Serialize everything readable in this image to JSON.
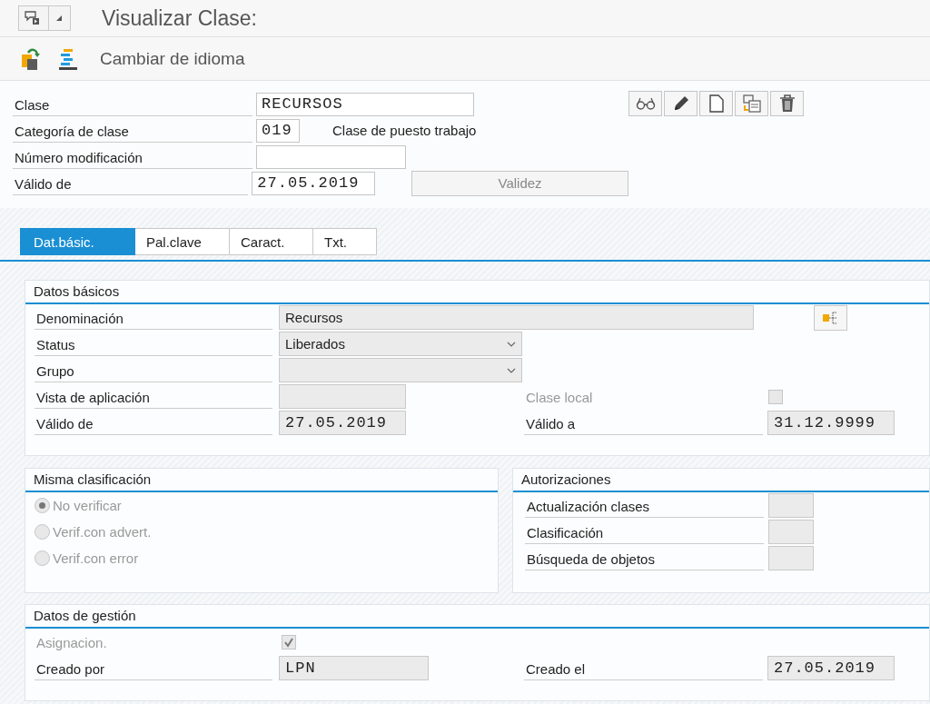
{
  "window": {
    "title": "Visualizar Clase:"
  },
  "toolbar": {
    "label": "Cambiar de idioma"
  },
  "header": {
    "fields": [
      {
        "kind": "text",
        "label": "Clase",
        "value": "RECURSOS"
      },
      {
        "kind": "short",
        "label": "Categoría de clase",
        "value": "019",
        "note": "Clase de puesto trabajo"
      },
      {
        "kind": "medium",
        "label": "Número modificación"
      },
      {
        "kind": "date",
        "label": "Válido de",
        "value": "27.05.2019",
        "button": {
          "label": "Validez",
          "disabled": true
        }
      }
    ]
  },
  "tabs": [
    {
      "label": "Dat.básic.",
      "selected": true
    },
    {
      "label": "Pal.clave",
      "selected": false
    },
    {
      "label": "Caract.",
      "selected": false
    },
    {
      "label": "Txt.",
      "selected": false
    }
  ],
  "basic_data": {
    "title": "Datos básicos",
    "rows": [
      {
        "kind": "text",
        "label": "Denominación",
        "value": "Recursos"
      },
      {
        "kind": "dropdown",
        "label": "Status",
        "value": "Liberados"
      },
      {
        "kind": "dropdown",
        "label": "Grupo"
      },
      {
        "kind": "input",
        "label": "Vista de aplicación",
        "side": {
          "kind": "checkbox",
          "label": "Clase local",
          "checked": false,
          "disabled": true
        }
      },
      {
        "kind": "date",
        "label": "Válido de",
        "value": "27.05.2019",
        "side": {
          "kind": "date",
          "label": "Válido a",
          "value": "31.12.9999"
        }
      }
    ]
  },
  "same_classification": {
    "title": "Misma clasificación",
    "options": [
      {
        "label": "No verificar",
        "selected": true,
        "disabled": true
      },
      {
        "label": "Verif.con advert.",
        "selected": false,
        "disabled": true
      },
      {
        "label": "Verif.con error",
        "selected": false,
        "disabled": true
      }
    ]
  },
  "authorizations": {
    "title": "Autorizaciones",
    "rows": [
      {
        "label": "Actualización clases"
      },
      {
        "label": "Clasificación"
      },
      {
        "label": "Búsqueda de objetos"
      }
    ]
  },
  "management": {
    "title": "Datos de gestión",
    "assignment": {
      "label": "Asignacion.",
      "checked": true,
      "disabled": true
    },
    "created_by": {
      "label": "Creado por",
      "value": "LPN"
    },
    "created_on": {
      "label": "Creado el",
      "value": "27.05.2019"
    }
  }
}
